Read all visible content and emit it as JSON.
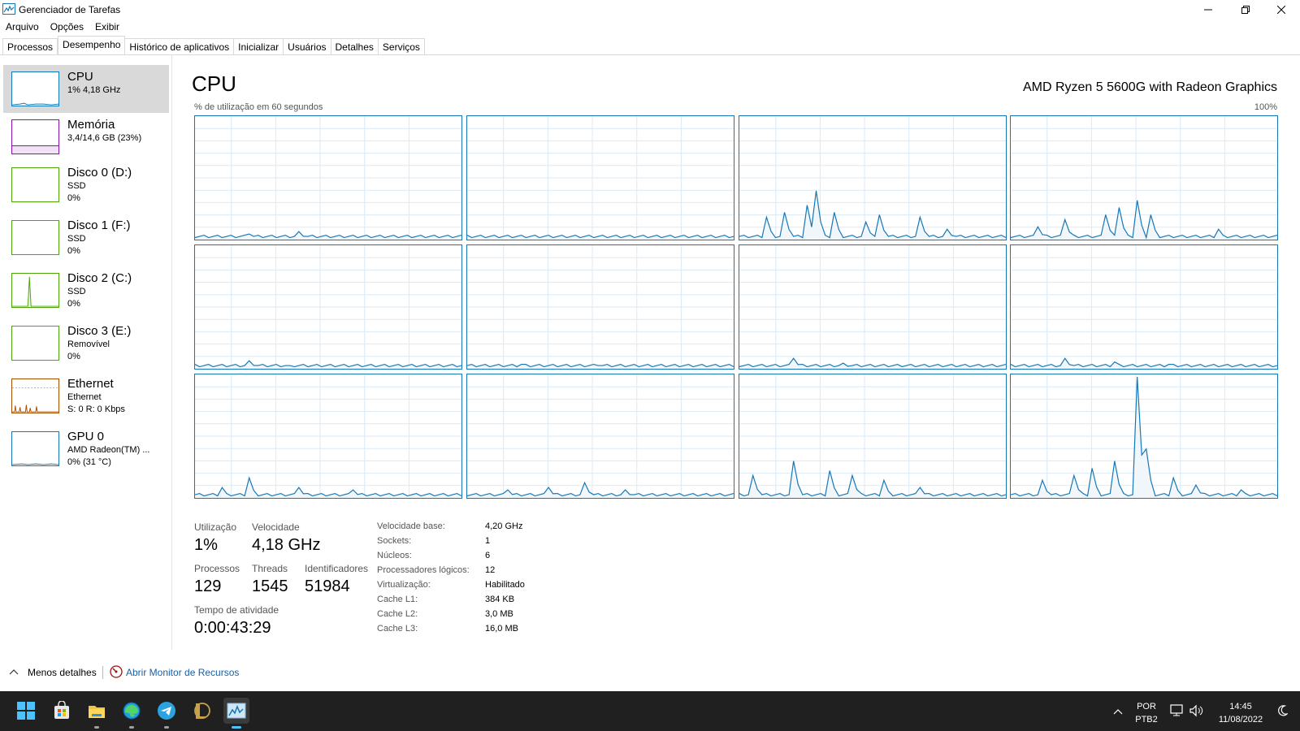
{
  "window": {
    "title": "Gerenciador de Tarefas"
  },
  "menu": [
    "Arquivo",
    "Opções",
    "Exibir"
  ],
  "tabs": [
    {
      "label": "Processos",
      "active": false
    },
    {
      "label": "Desempenho",
      "active": true
    },
    {
      "label": "Histórico de aplicativos",
      "active": false
    },
    {
      "label": "Inicializar",
      "active": false
    },
    {
      "label": "Usuários",
      "active": false
    },
    {
      "label": "Detalhes",
      "active": false
    },
    {
      "label": "Serviços",
      "active": false
    }
  ],
  "sidebar": {
    "items": [
      {
        "name": "CPU",
        "line1": "1% 4,18 GHz",
        "line2": "",
        "color": "#1477b8",
        "selected": true
      },
      {
        "name": "Memória",
        "line1": "3,4/14,6 GB (23%)",
        "line2": "",
        "color": "#8b12ae",
        "selected": false
      },
      {
        "name": "Disco 0 (D:)",
        "line1": "SSD",
        "line2": "0%",
        "color": "#4da60c",
        "selected": false
      },
      {
        "name": "Disco 1 (F:)",
        "line1": "SSD",
        "line2": "0%",
        "color": "#4da60c",
        "selected": false
      },
      {
        "name": "Disco 2 (C:)",
        "line1": "SSD",
        "line2": "0%",
        "color": "#4da60c",
        "selected": false
      },
      {
        "name": "Disco 3 (E:)",
        "line1": "Removível",
        "line2": "0%",
        "color": "#4da60c",
        "selected": false
      },
      {
        "name": "Ethernet",
        "line1": "Ethernet",
        "line2": "S: 0 R: 0 Kbps",
        "color": "#a74f01",
        "selected": false
      },
      {
        "name": "GPU 0",
        "line1": "AMD Radeon(TM) ...",
        "line2": "0% (31 °C)",
        "color": "#1477b8",
        "selected": false
      }
    ]
  },
  "main": {
    "title": "CPU",
    "model": "AMD Ryzen 5 5600G with Radeon Graphics",
    "util_caption": "% de utilização em 60 segundos",
    "max_label": "100%",
    "graph_color": "#1477b8"
  },
  "stats": {
    "utilizacao_label": "Utilização",
    "utilizacao_value": "1%",
    "velocidade_label": "Velocidade",
    "velocidade_value": "4,18 GHz",
    "processos_label": "Processos",
    "processos_value": "129",
    "threads_label": "Threads",
    "threads_value": "1545",
    "identificadores_label": "Identificadores",
    "identificadores_value": "51984",
    "tempo_label": "Tempo de atividade",
    "tempo_value": "0:00:43:29"
  },
  "specs": [
    {
      "label": "Velocidade base:",
      "value": "4,20 GHz"
    },
    {
      "label": "Sockets:",
      "value": "1"
    },
    {
      "label": "Núcleos:",
      "value": "6"
    },
    {
      "label": "Processadores lógicos:",
      "value": "12"
    },
    {
      "label": "Virtualização:",
      "value": "Habilitado"
    },
    {
      "label": "Cache L1:",
      "value": "384 KB"
    },
    {
      "label": "Cache L2:",
      "value": "3,0 MB"
    },
    {
      "label": "Cache L3:",
      "value": "16,0 MB"
    }
  ],
  "footer": {
    "less_details": "Menos detalhes",
    "resource_monitor": "Abrir Monitor de Recursos"
  },
  "taskbar": {
    "lang_top": "POR",
    "lang_bottom": "PTB2",
    "time": "14:45",
    "date": "11/08/2022"
  }
}
